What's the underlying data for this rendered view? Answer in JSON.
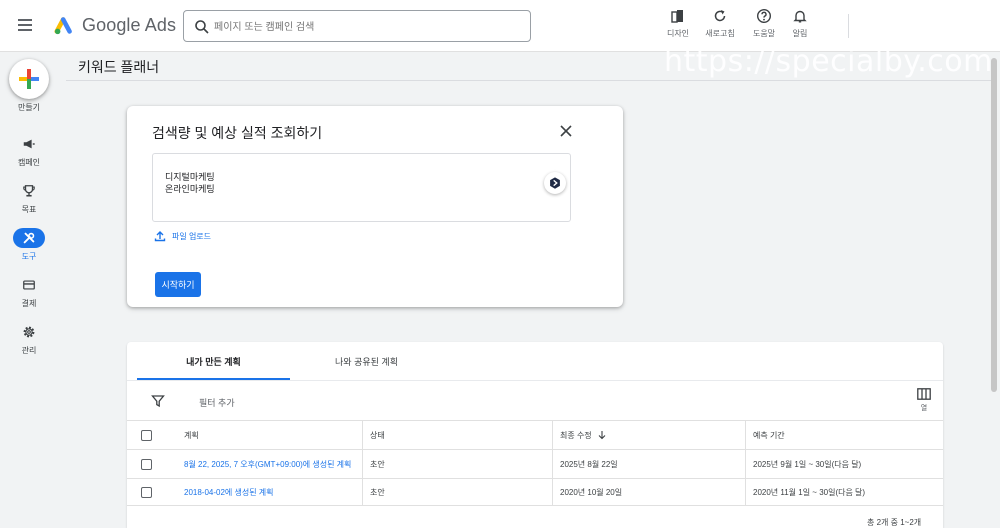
{
  "topbar": {
    "brand": "Google Ads",
    "search_placeholder": "페이지 또는 캠페인 검색",
    "actions": [
      {
        "label": "디자인",
        "icon": "appearance-icon"
      },
      {
        "label": "새로고침",
        "icon": "refresh-icon"
      },
      {
        "label": "도움말",
        "icon": "help-icon"
      },
      {
        "label": "알림",
        "icon": "bell-icon"
      }
    ]
  },
  "rail": {
    "create_label": "만들기",
    "items": [
      {
        "label": "캠페인",
        "icon": "megaphone-icon"
      },
      {
        "label": "목표",
        "icon": "trophy-icon"
      },
      {
        "label": "도구",
        "icon": "tools-icon",
        "active": true
      },
      {
        "label": "결제",
        "icon": "credit-card-icon"
      },
      {
        "label": "관리",
        "icon": "gear-icon"
      }
    ]
  },
  "page": {
    "title": "키워드 플래너",
    "watermark": "https://specialby.com"
  },
  "card": {
    "title": "검색량 및 예상 실적 조회하기",
    "keywords": [
      "디지털마케팅",
      "온라인마케팅"
    ],
    "upload_label": "파일 업로드",
    "start_label": "시작하기"
  },
  "plans": {
    "tabs": [
      {
        "label": "내가 만든 계획",
        "active": true
      },
      {
        "label": "나와 공유된 계획",
        "active": false
      }
    ],
    "filter_label": "필터 추가",
    "columns_label": "열",
    "headers": {
      "plan": "계획",
      "status": "상태",
      "modified": "최종 수정",
      "period": "예측 기간"
    },
    "rows": [
      {
        "plan": "8월 22, 2025, 7 오후(GMT+09:00)에 생성된 계획",
        "status": "초안",
        "modified": "2025년 8월 22일",
        "period": "2025년 9월 1일 ~ 30일(다음 달)"
      },
      {
        "plan": "2018-04-02에 생성된 계획",
        "status": "초안",
        "modified": "2020년 10월 20일",
        "period": "2020년 11월 1일 ~ 30일(다음 달)"
      }
    ],
    "footer": "총 2개 중 1~2개"
  },
  "colors": {
    "accent": "#1a73e8",
    "background": "#f1f3f4"
  }
}
